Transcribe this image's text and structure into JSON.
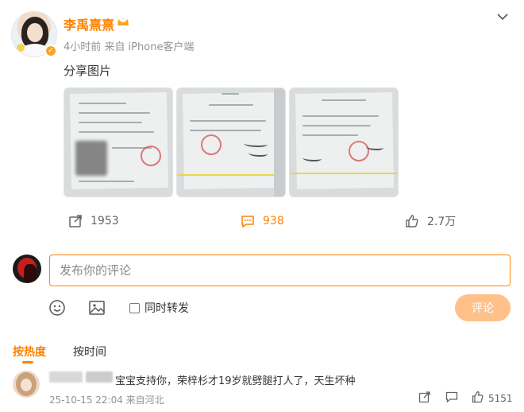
{
  "post": {
    "username": "李禹熹熹",
    "time": "4小时前",
    "source": "来自 iPhone客户端",
    "text": "分享图片",
    "badge_symbol": "✓"
  },
  "images": [
    {
      "name": "document-photo-1"
    },
    {
      "name": "document-photo-2"
    },
    {
      "name": "document-photo-3"
    }
  ],
  "actions": {
    "repost_count": "1953",
    "comment_count": "938",
    "like_count": "2.7万"
  },
  "composer": {
    "placeholder": "发布你的评论",
    "forward_label": "同时转发",
    "submit_label": "评论"
  },
  "sort": {
    "by_hot": "按热度",
    "by_time": "按时间"
  },
  "comment": {
    "text": "宝宝支持你，荣梓杉才19岁就劈腿打人了，天生坏种",
    "time": "25-10-15 22:04 来自河北",
    "likes": "5151"
  },
  "colors": {
    "accent": "#ff8200",
    "submit_disabled": "#ffc08a",
    "muted": "#939393"
  },
  "icons": [
    "crown-icon",
    "chevron-down-icon",
    "repost-icon",
    "comment-icon",
    "like-icon",
    "emoji-icon",
    "image-icon",
    "share-icon",
    "reply-icon"
  ]
}
